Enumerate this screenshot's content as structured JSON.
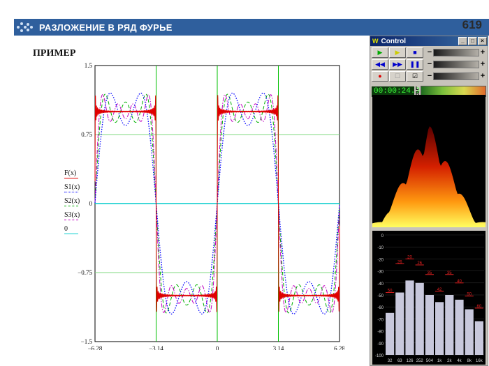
{
  "header": {
    "title": "РАЗЛОЖЕНИЕ В РЯД ФУРЬЕ",
    "page_number": "619"
  },
  "example_label": "ПРИМЕР",
  "chart_data": {
    "type": "line",
    "xlim": [
      -6.28,
      6.28
    ],
    "ylim": [
      -1.5,
      1.5
    ],
    "x_ticks": [
      "−6.28",
      "−3.14",
      "0",
      "3.14",
      "6.28"
    ],
    "y_ticks": [
      "1.5",
      "0.75",
      "0",
      "−0.75",
      "−1.5"
    ],
    "series": [
      {
        "name": "F(x)",
        "color": "#e00000",
        "function": "Fourier partial sum of square wave, many terms",
        "harmonics": 60
      },
      {
        "name": "S1(x)",
        "color": "#0000ff",
        "function": "(4/π)·(sin x + sin 3x/3)",
        "harmonics": 2
      },
      {
        "name": "S2(x)",
        "color": "#00b000",
        "function": "(4/π)·Σ sin((2k−1)x)/(2k−1), k=1..3",
        "harmonics": 3
      },
      {
        "name": "S3(x)",
        "color": "#c000c0",
        "function": "(4/π)·Σ sin((2k−1)x)/(2k−1), k=1..4",
        "harmonics": 4
      },
      {
        "name": "0",
        "color": "#00cccc",
        "function": "y = 0",
        "harmonics": 0
      }
    ]
  },
  "control": {
    "title": "Control",
    "time": "00:00:24.3",
    "window_buttons": [
      "_",
      "□",
      "×"
    ],
    "eq_db_ticks": [
      "0",
      "-10",
      "-20",
      "-30",
      "-40",
      "-50",
      "-60",
      "-70",
      "-80",
      "-90",
      "-100"
    ],
    "eq_bands": [
      "32",
      "63",
      "126",
      "252",
      "504",
      "1k",
      "2k",
      "4k",
      "8k",
      "16k"
    ],
    "eq_levels": [
      -65,
      -48,
      -38,
      -40,
      -50,
      -56,
      -50,
      -54,
      -62,
      -72
    ],
    "eq_peak_labels": [
      "50",
      "26",
      "20",
      "26",
      "35",
      "42",
      "35",
      "40",
      "50",
      "60"
    ],
    "eq_peaks": [
      -48,
      -24,
      -20,
      -25,
      -33,
      -47,
      -33,
      -40,
      -51,
      -61
    ]
  }
}
